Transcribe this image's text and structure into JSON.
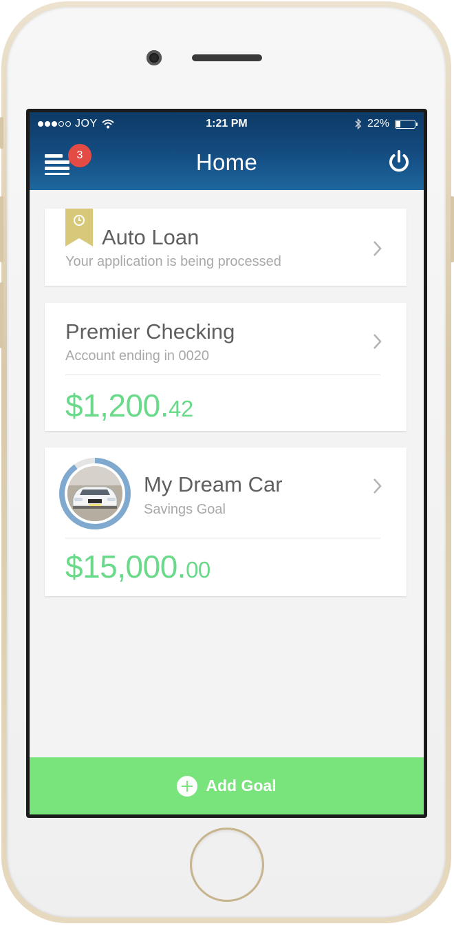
{
  "status_bar": {
    "carrier": "JOY",
    "time": "1:21 PM",
    "battery": "22%",
    "battery_level": 0.22,
    "signal_bars_filled": 3,
    "signal_bars_total": 5,
    "icons": [
      "signal-dots",
      "wifi-icon",
      "bluetooth-icon",
      "battery-icon"
    ]
  },
  "nav": {
    "title": "Home",
    "menu_icon": "menu-icon",
    "notification_count": "3",
    "power_icon": "power-icon"
  },
  "cards": {
    "auto_loan": {
      "title": "Auto Loan",
      "subtitle": "Your application is being processed",
      "icon": "clock-ribbon-icon"
    },
    "checking": {
      "title": "Premier Checking",
      "subtitle": "Account ending in 0020",
      "amount_main": "$1,200.",
      "amount_cents": "42"
    },
    "goal": {
      "title": "My Dream Car",
      "subtitle": "Savings Goal",
      "amount_main": "$15,000.",
      "amount_cents": "00",
      "progress": 0.9
    }
  },
  "actions": {
    "add_goal": "Add Goal"
  },
  "colors": {
    "header_top": "#0d3a66",
    "header_bottom": "#1d679e",
    "badge": "#e34b44",
    "amount_green": "#6ad98a",
    "add_goal_bg": "#79e47c",
    "ribbon": "#d8c97a",
    "goal_ring": "#7fa9cf",
    "phone_gold": "#d9c9a9"
  }
}
